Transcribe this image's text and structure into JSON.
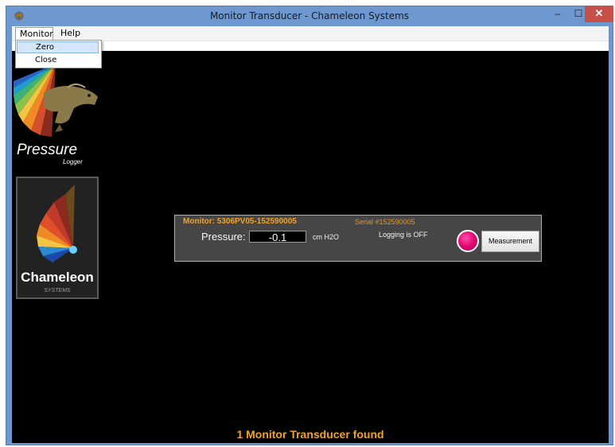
{
  "window": {
    "title": "Monitor Transducer - Chameleon Systems",
    "minimize_glyph": "‒",
    "maximize_glyph": "☐",
    "close_glyph": "✕",
    "app_icon": "chameleon-app-icon"
  },
  "menubar": {
    "items": [
      {
        "label": "Monitor"
      },
      {
        "label": "Help"
      }
    ]
  },
  "dropdown": {
    "items": [
      {
        "label": "Zero"
      },
      {
        "label": "Close"
      }
    ]
  },
  "logos": {
    "pressure_logo": {
      "title": "Pressure",
      "subtitle": "Logger"
    },
    "chameleon_logo": {
      "title": "Chameleon",
      "subtitle": "SYSTEMS"
    }
  },
  "monitor_panel": {
    "device_name": "Monitor: 5306PV05-152590005",
    "serial": "Serial #152590005",
    "pressure_label": "Pressure:",
    "pressure_value": "-0.1",
    "unit": "cm H2O",
    "logging_status": "Logging is OFF",
    "measurement_button": "Measurement"
  },
  "status_footer": "1 Monitor Transducer found",
  "colors": {
    "accent_orange": "#f0a32a",
    "led": "#e0006e",
    "title_bar": "#6d97cf",
    "close_button": "#c7504a"
  }
}
